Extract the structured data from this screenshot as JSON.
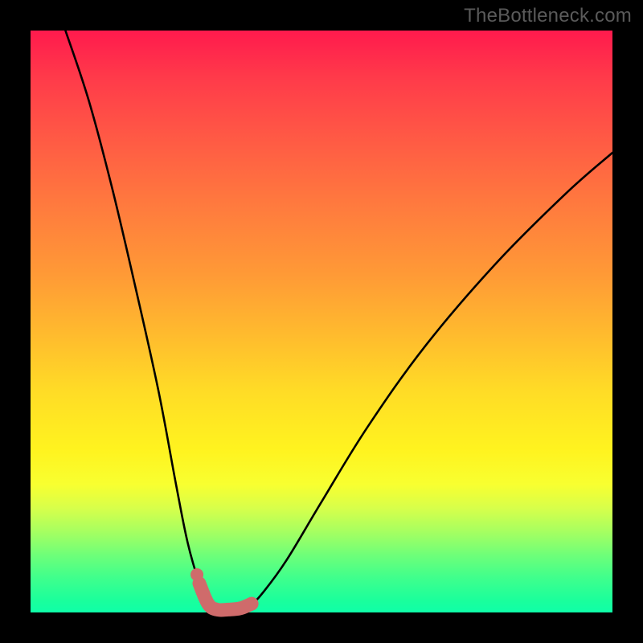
{
  "watermark": "TheBottleneck.com",
  "colors": {
    "frame": "#000000",
    "gradient_top": "#ff1a4d",
    "gradient_bottom": "#0fffa8",
    "curve": "#000000",
    "highlight": "#cf6b6b"
  },
  "chart_data": {
    "type": "line",
    "title": "",
    "xlabel": "",
    "ylabel": "",
    "xlim": [
      0,
      100
    ],
    "ylim": [
      0,
      100
    ],
    "series": [
      {
        "name": "bottleneck-curve",
        "x": [
          6,
          10,
          14,
          18,
          22,
          25,
          27,
          29,
          30.5,
          32,
          34,
          36,
          38,
          40,
          44,
          50,
          58,
          68,
          80,
          92,
          100
        ],
        "values": [
          100,
          88,
          73,
          56,
          38,
          22,
          12,
          5,
          1.5,
          0.5,
          0.5,
          0.7,
          1.5,
          3.5,
          9,
          19,
          32,
          46,
          60,
          72,
          79
        ]
      }
    ],
    "highlight_segment": {
      "name": "minimum-highlight",
      "x": [
        29.0,
        30.5,
        32.0,
        34.0,
        36.0,
        38.0
      ],
      "values": [
        5.0,
        1.5,
        0.5,
        0.5,
        0.7,
        1.5
      ]
    },
    "highlight_dot": {
      "x": 28.6,
      "value": 6.5
    }
  }
}
